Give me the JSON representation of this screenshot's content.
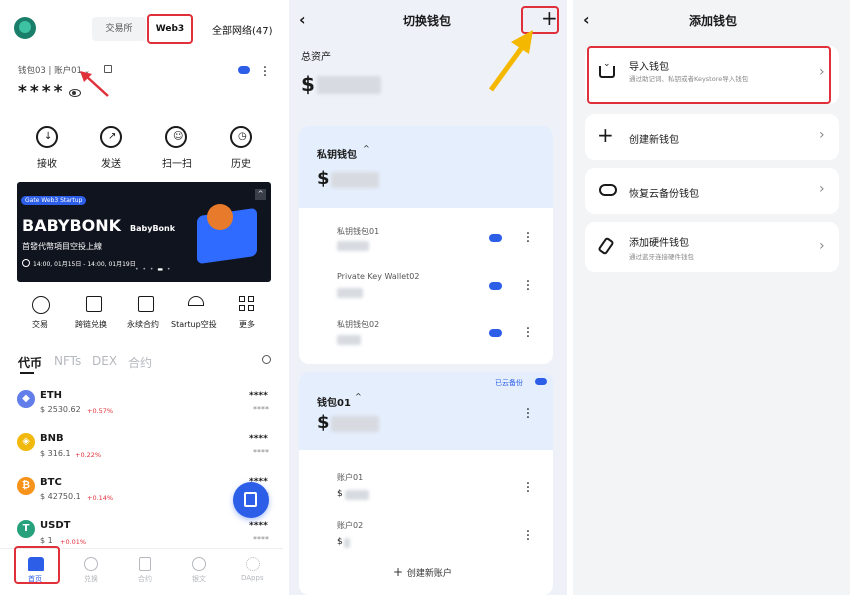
{
  "p1": {
    "tabs": [
      "交易所",
      "Web3",
      "全部网络(47)"
    ],
    "account": "钱包03 | 账户01",
    "balance_mask": "****",
    "actions": [
      "接收",
      "发送",
      "扫一扫",
      "历史"
    ],
    "banner": {
      "tag": "Gate Web3 Startup",
      "title": "BABYBONK",
      "subtitle": "BabyBonk",
      "desc": "首發代幣項目空投上線",
      "dates": "14:00, 01月15日 - 14:00, 01月19日"
    },
    "features": [
      "交易",
      "跨链兑换",
      "永续合约",
      "Startup空投",
      "更多"
    ],
    "asset_tabs": [
      "代币",
      "NFTs",
      "DEX",
      "合约"
    ],
    "coins": [
      {
        "symbol": "ETH",
        "price": "$ 2530.62",
        "change": "+0.57%",
        "amount": "****",
        "sub": "****",
        "color": "#627eea",
        "glyph": "◆"
      },
      {
        "symbol": "BNB",
        "price": "$ 316.1",
        "change": "+0.22%",
        "amount": "****",
        "sub": "****",
        "color": "#f0b90b",
        "glyph": "◈"
      },
      {
        "symbol": "BTC",
        "price": "$ 42750.1",
        "change": "+0.14%",
        "amount": "****",
        "sub": "****",
        "color": "#f7931a",
        "glyph": "₿"
      },
      {
        "symbol": "USDT",
        "price": "$ 1",
        "change": "+0.01%",
        "amount": "****",
        "sub": "****",
        "color": "#26a17b",
        "glyph": "T"
      }
    ],
    "bottom_nav": [
      "首页",
      "兑换",
      "合约",
      "银文",
      "DApps"
    ]
  },
  "p2": {
    "title": "切换钱包",
    "total_label": "总资产",
    "currency": "$",
    "group1": {
      "name": "私钥钱包",
      "items": [
        {
          "name": "私钥钱包01"
        },
        {
          "name": "Private Key Wallet02"
        },
        {
          "name": "私钥钱包02"
        }
      ]
    },
    "cloud_backup": "已云备份",
    "group2": {
      "name": "钱包01",
      "items": [
        {
          "name": "账户01"
        },
        {
          "name": "账户02"
        }
      ],
      "create_label": "创建新账户"
    }
  },
  "p3": {
    "title": "添加钱包",
    "options": [
      {
        "title": "导入钱包",
        "desc": "通过助记词、私钥或者Keystore导入钱包",
        "icon": "import-icon"
      },
      {
        "title": "创建新钱包",
        "desc": "",
        "icon": "plus-icon"
      },
      {
        "title": "恢复云备份钱包",
        "desc": "",
        "icon": "cloud-restore-icon"
      },
      {
        "title": "添加硬件钱包",
        "desc": "通过蓝牙连接硬件钱包",
        "icon": "hardware-wallet-icon"
      }
    ]
  },
  "colors": {
    "accent": "#2c5ee8",
    "up": "#e0303a",
    "red_box": "#e0303a",
    "arrow": "#f5b800"
  }
}
